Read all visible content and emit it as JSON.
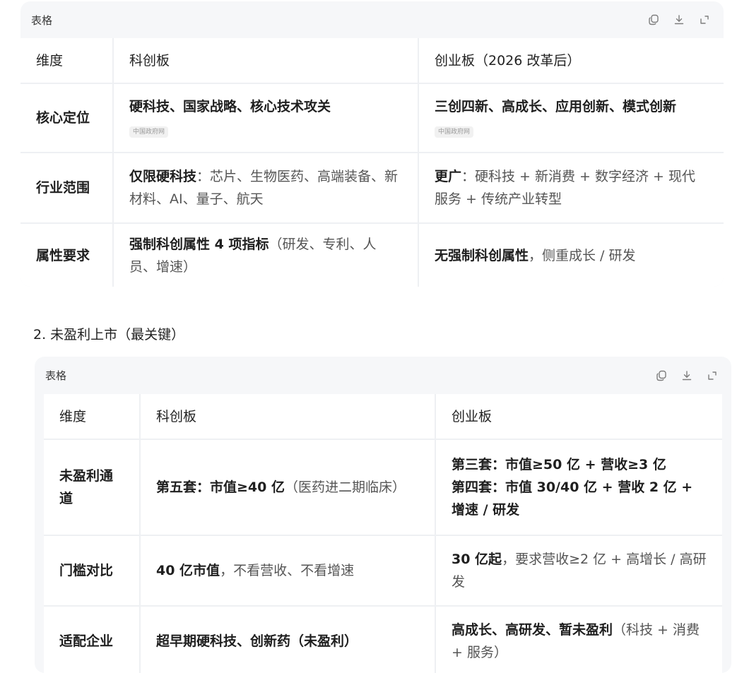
{
  "table1": {
    "title": "表格",
    "headers": [
      "维度",
      "科创板",
      "创业板（2026 改革后）"
    ],
    "rows": [
      {
        "label": "核心定位",
        "col1": {
          "bold": "硬科技、国家战略、核心技术攻关",
          "rest": "",
          "source": "中国政府网"
        },
        "col2": {
          "bold": "三创四新、高成长、应用创新、模式创新",
          "rest": "",
          "source": "中国政府网"
        }
      },
      {
        "label": "行业范围",
        "col1": {
          "bold": "仅限硬科技",
          "rest": "：芯片、生物医药、高端装备、新材料、AI、量子、航天"
        },
        "col2": {
          "bold": "更广",
          "rest": "：硬科技 + 新消费 + 数字经济 + 现代服务 + 传统产业转型"
        }
      },
      {
        "label": "属性要求",
        "col1": {
          "bold": "强制科创属性 4 项指标",
          "rest": "（研发、专利、人员、增速）"
        },
        "col2": {
          "bold": "无强制科创属性",
          "rest": "，侧重成长 / 研发"
        }
      }
    ]
  },
  "section_title": "2. 未盈利上市（最关键）",
  "table2": {
    "title": "表格",
    "headers": [
      "维度",
      "科创板",
      "创业板"
    ],
    "rows": [
      {
        "label": "未盈利通道",
        "col1": {
          "bold": "第五套：市值≥40 亿",
          "rest": "（医药进二期临床）"
        },
        "col2": {
          "bold": "第三套：市值≥50 亿 + 营收≥3 亿",
          "bold2": "第四套：市值 30/40 亿 + 营收 2 亿 + 增速 / 研发"
        }
      },
      {
        "label": "门槛对比",
        "col1": {
          "bold": "40 亿市值",
          "rest": "，不看营收、不看增速"
        },
        "col2": {
          "bold": "30 亿起",
          "rest": "，要求营收≥2 亿 + 高增长 / 高研发"
        }
      },
      {
        "label": "适配企业",
        "col1": {
          "bold": "超早期硬科技、创新药（未盈利）",
          "rest": ""
        },
        "col2": {
          "bold": "高成长、高研发、暂未盈利",
          "rest": "（科技 + 消费 + 服务）"
        }
      }
    ]
  },
  "icons": {
    "copy": "copy-icon",
    "download": "download-icon",
    "expand": "expand-icon"
  }
}
